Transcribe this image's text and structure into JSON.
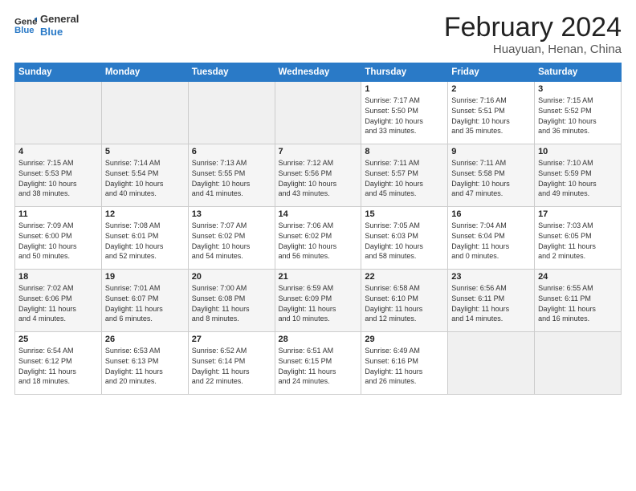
{
  "logo": {
    "line1": "General",
    "line2": "Blue"
  },
  "title": "February 2024",
  "subtitle": "Huayuan, Henan, China",
  "headers": [
    "Sunday",
    "Monday",
    "Tuesday",
    "Wednesday",
    "Thursday",
    "Friday",
    "Saturday"
  ],
  "weeks": [
    [
      {
        "day": "",
        "info": ""
      },
      {
        "day": "",
        "info": ""
      },
      {
        "day": "",
        "info": ""
      },
      {
        "day": "",
        "info": ""
      },
      {
        "day": "1",
        "info": "Sunrise: 7:17 AM\nSunset: 5:50 PM\nDaylight: 10 hours\nand 33 minutes."
      },
      {
        "day": "2",
        "info": "Sunrise: 7:16 AM\nSunset: 5:51 PM\nDaylight: 10 hours\nand 35 minutes."
      },
      {
        "day": "3",
        "info": "Sunrise: 7:15 AM\nSunset: 5:52 PM\nDaylight: 10 hours\nand 36 minutes."
      }
    ],
    [
      {
        "day": "4",
        "info": "Sunrise: 7:15 AM\nSunset: 5:53 PM\nDaylight: 10 hours\nand 38 minutes."
      },
      {
        "day": "5",
        "info": "Sunrise: 7:14 AM\nSunset: 5:54 PM\nDaylight: 10 hours\nand 40 minutes."
      },
      {
        "day": "6",
        "info": "Sunrise: 7:13 AM\nSunset: 5:55 PM\nDaylight: 10 hours\nand 41 minutes."
      },
      {
        "day": "7",
        "info": "Sunrise: 7:12 AM\nSunset: 5:56 PM\nDaylight: 10 hours\nand 43 minutes."
      },
      {
        "day": "8",
        "info": "Sunrise: 7:11 AM\nSunset: 5:57 PM\nDaylight: 10 hours\nand 45 minutes."
      },
      {
        "day": "9",
        "info": "Sunrise: 7:11 AM\nSunset: 5:58 PM\nDaylight: 10 hours\nand 47 minutes."
      },
      {
        "day": "10",
        "info": "Sunrise: 7:10 AM\nSunset: 5:59 PM\nDaylight: 10 hours\nand 49 minutes."
      }
    ],
    [
      {
        "day": "11",
        "info": "Sunrise: 7:09 AM\nSunset: 6:00 PM\nDaylight: 10 hours\nand 50 minutes."
      },
      {
        "day": "12",
        "info": "Sunrise: 7:08 AM\nSunset: 6:01 PM\nDaylight: 10 hours\nand 52 minutes."
      },
      {
        "day": "13",
        "info": "Sunrise: 7:07 AM\nSunset: 6:02 PM\nDaylight: 10 hours\nand 54 minutes."
      },
      {
        "day": "14",
        "info": "Sunrise: 7:06 AM\nSunset: 6:02 PM\nDaylight: 10 hours\nand 56 minutes."
      },
      {
        "day": "15",
        "info": "Sunrise: 7:05 AM\nSunset: 6:03 PM\nDaylight: 10 hours\nand 58 minutes."
      },
      {
        "day": "16",
        "info": "Sunrise: 7:04 AM\nSunset: 6:04 PM\nDaylight: 11 hours\nand 0 minutes."
      },
      {
        "day": "17",
        "info": "Sunrise: 7:03 AM\nSunset: 6:05 PM\nDaylight: 11 hours\nand 2 minutes."
      }
    ],
    [
      {
        "day": "18",
        "info": "Sunrise: 7:02 AM\nSunset: 6:06 PM\nDaylight: 11 hours\nand 4 minutes."
      },
      {
        "day": "19",
        "info": "Sunrise: 7:01 AM\nSunset: 6:07 PM\nDaylight: 11 hours\nand 6 minutes."
      },
      {
        "day": "20",
        "info": "Sunrise: 7:00 AM\nSunset: 6:08 PM\nDaylight: 11 hours\nand 8 minutes."
      },
      {
        "day": "21",
        "info": "Sunrise: 6:59 AM\nSunset: 6:09 PM\nDaylight: 11 hours\nand 10 minutes."
      },
      {
        "day": "22",
        "info": "Sunrise: 6:58 AM\nSunset: 6:10 PM\nDaylight: 11 hours\nand 12 minutes."
      },
      {
        "day": "23",
        "info": "Sunrise: 6:56 AM\nSunset: 6:11 PM\nDaylight: 11 hours\nand 14 minutes."
      },
      {
        "day": "24",
        "info": "Sunrise: 6:55 AM\nSunset: 6:11 PM\nDaylight: 11 hours\nand 16 minutes."
      }
    ],
    [
      {
        "day": "25",
        "info": "Sunrise: 6:54 AM\nSunset: 6:12 PM\nDaylight: 11 hours\nand 18 minutes."
      },
      {
        "day": "26",
        "info": "Sunrise: 6:53 AM\nSunset: 6:13 PM\nDaylight: 11 hours\nand 20 minutes."
      },
      {
        "day": "27",
        "info": "Sunrise: 6:52 AM\nSunset: 6:14 PM\nDaylight: 11 hours\nand 22 minutes."
      },
      {
        "day": "28",
        "info": "Sunrise: 6:51 AM\nSunset: 6:15 PM\nDaylight: 11 hours\nand 24 minutes."
      },
      {
        "day": "29",
        "info": "Sunrise: 6:49 AM\nSunset: 6:16 PM\nDaylight: 11 hours\nand 26 minutes."
      },
      {
        "day": "",
        "info": ""
      },
      {
        "day": "",
        "info": ""
      }
    ]
  ]
}
